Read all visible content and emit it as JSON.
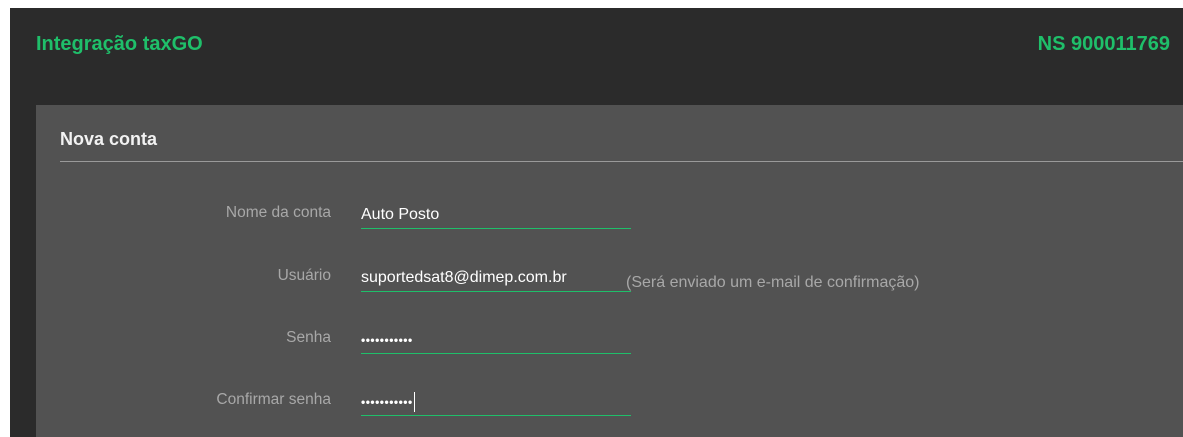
{
  "header": {
    "title": "Integração taxGO",
    "serial": "NS 900011769"
  },
  "panel": {
    "title": "Nova conta"
  },
  "form": {
    "account_name": {
      "label": "Nome da conta",
      "value": "Auto Posto"
    },
    "user": {
      "label": "Usuário",
      "value": "suportedsat8@dimep.com.br",
      "hint": "(Será enviado um e-mail de confirmação)"
    },
    "password": {
      "label": "Senha",
      "masked_value": "•••••••••••"
    },
    "confirm_password": {
      "label": "Confirmar senha",
      "masked_value": "•••••••••••"
    }
  },
  "colors": {
    "accent": "#1fbf6a",
    "background": "#2b2b2b",
    "panel": "#525252",
    "label": "#a8a8a8"
  }
}
